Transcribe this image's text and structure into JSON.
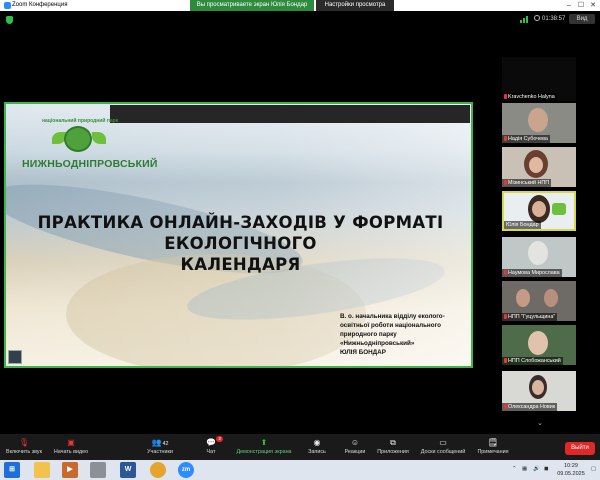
{
  "window": {
    "title": "Zoom Конференция",
    "viewing_banner": "Вы просматриваете экран Юлія Бондар",
    "view_settings": "Настройки просмотра"
  },
  "meeting": {
    "timer": "01:38:57",
    "view_button": "Вид"
  },
  "slide": {
    "logo_text": "НИЖНЬОДНІПРОВСЬКИЙ",
    "logo_arc_text": "національний природний парк",
    "title_line1": "ПРАКТИКА ОНЛАЙН-ЗАХОДІВ У ФОРМАТІ ЕКОЛОГІЧНОГО",
    "title_line2": "КАЛЕНДАРЯ",
    "subtitle_lines": [
      "В. о. начальника відділу еколого-",
      "освітньої роботи національного",
      "природного парку",
      "«Нижньодніпровський»",
      "ЮЛІЯ БОНДАР"
    ]
  },
  "participants": [
    {
      "name": "Kravchenko Halyna",
      "muted": true
    },
    {
      "name": "Надія Субочева",
      "muted": true
    },
    {
      "name": "Мізинський НПП",
      "muted": true
    },
    {
      "name": "Юлія Бондар",
      "muted": false
    },
    {
      "name": "Наумова Мирослава",
      "muted": true
    },
    {
      "name": "НПП \"Гуцульщина\"",
      "muted": true
    },
    {
      "name": "НПП Слобожанський",
      "muted": true
    },
    {
      "name": "Олександра Новик",
      "muted": true
    }
  ],
  "toolbar": {
    "audio": "Включить звук",
    "video": "Начать видео",
    "participants": "Участники",
    "participants_count": "42",
    "chat": "Чат",
    "chat_badge": "2",
    "share": "Демонстрация экрана",
    "record": "Запись",
    "reactions": "Реакции",
    "apps": "Приложения",
    "whiteboard": "Доски сообщений",
    "notes": "Примечания",
    "leave": "Выйти"
  },
  "taskbar": {
    "zoom_label": "zm",
    "word_label": "W",
    "time": "10:29",
    "date": "09.05.2025"
  },
  "colors": {
    "share_green": "#3db54a",
    "leave_red": "#e02828",
    "active_speaker": "#d8d84a"
  }
}
